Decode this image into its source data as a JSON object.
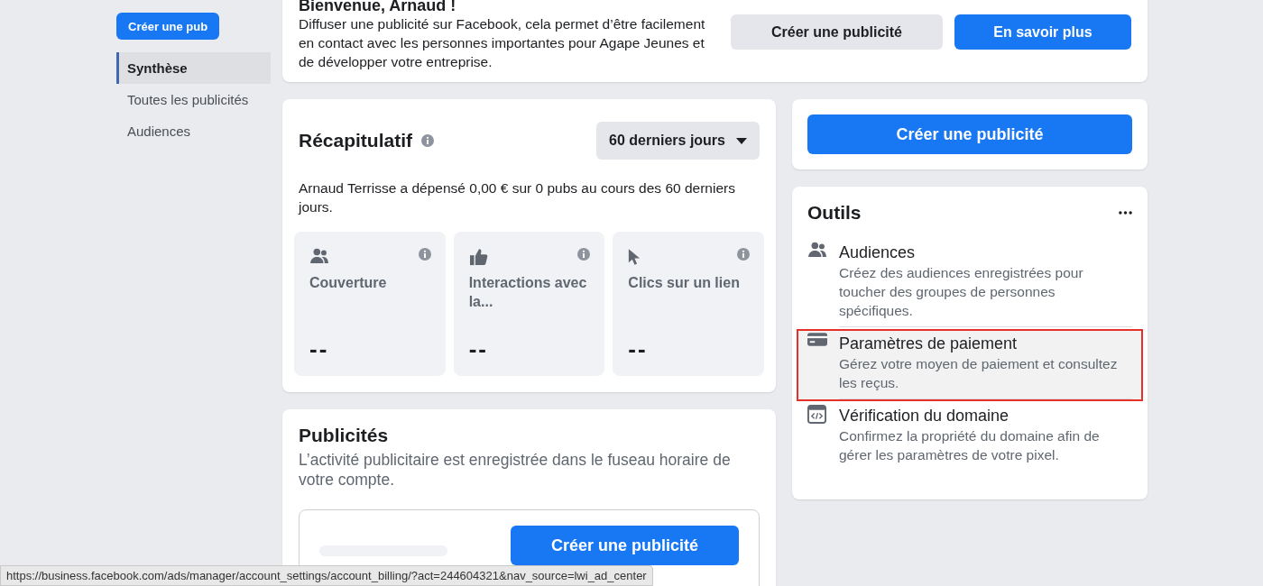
{
  "sidebar": {
    "create_button": "Créer une pub",
    "items": [
      {
        "label": "Synthèse",
        "selected": true
      },
      {
        "label": "Toutes les publicités",
        "selected": false
      },
      {
        "label": "Audiences",
        "selected": false
      }
    ]
  },
  "welcome": {
    "title": "Bienvenue, Arnaud !",
    "text": "Diffuser une publicité sur Facebook, cela permet d’être facilement en contact avec les personnes importantes pour Agape Jeunes et de développer votre entreprise.",
    "buttons": [
      {
        "label": "Créer une publicité",
        "kind": "secondary"
      },
      {
        "label": "En savoir plus",
        "kind": "primary"
      }
    ]
  },
  "summary": {
    "title": "Récapitulatif",
    "period": "60 derniers jours",
    "text": "Arnaud Terrisse a dépensé 0,00 € sur 0 pubs au cours des 60 derniers jours.",
    "metrics": [
      {
        "kind": "people",
        "label": "Couverture",
        "value": "--"
      },
      {
        "kind": "like",
        "label": "Interactions avec la...",
        "value": "--"
      },
      {
        "kind": "cursor",
        "label": "Clics sur un lien",
        "value": "--"
      }
    ]
  },
  "ads": {
    "title": "Publicités",
    "text": "L’activité publicitaire est enregistrée dans le fuseau horaire de votre compte.",
    "button": "Créer une publicité"
  },
  "create": {
    "button": "Créer une publicité"
  },
  "tools": {
    "title": "Outils",
    "items": [
      {
        "kind": "people",
        "title": "Audiences",
        "text": "Créez des audiences enregistrées pour toucher des groupes de personnes spécifiques.",
        "highlighted": false
      },
      {
        "kind": "card",
        "title": "Paramètres de paiement",
        "text": "Gérez votre moyen de paiement et consultez les reçus.",
        "highlighted": true
      },
      {
        "kind": "code",
        "title": "Vérification du domaine",
        "text": "Confirmez la propriété du domaine afin de gérer les paramètres de votre pixel.",
        "highlighted": false
      }
    ]
  },
  "status_bar": {
    "url": "https://business.facebook.com/ads/manager/account_settings/account_billing/?act=244604321&nav_source=lwi_ad_center"
  }
}
